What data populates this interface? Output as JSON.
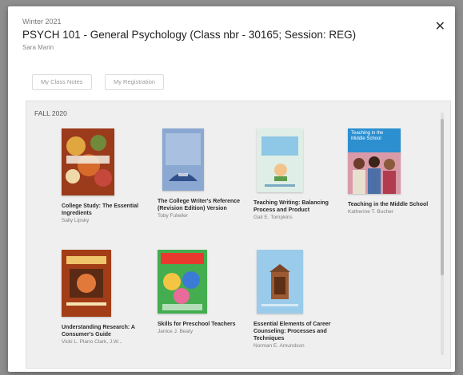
{
  "header": {
    "term": "Winter 2021",
    "title": "PSYCH 101 - General Psychology (Class nbr - 30165; Session: REG)",
    "subtitle": "Sara Marin"
  },
  "buttons": {
    "my_class_notes": "My Class Notes",
    "my_registration": "My Registration"
  },
  "panel": {
    "semester": "FALL 2020"
  },
  "books": [
    {
      "title": "College Study: The Essential Ingredients",
      "author": "Sally Lipsky"
    },
    {
      "title": "The College Writer's Reference (Revision Edition) Version",
      "author": "Toby Fulwiler"
    },
    {
      "title": "Teaching Writing: Balancing Process and Product",
      "author": "Gail E. Tompkins"
    },
    {
      "title": "Teaching in the Middle School",
      "author": "Katherine T. Bucher"
    },
    {
      "title": "Understanding Research: A Consumer's Guide",
      "author": "Vicki L. Plano Clark, J.W..."
    },
    {
      "title": "Skills for Preschool Teachers",
      "author": "Janice J. Beaty"
    },
    {
      "title": "Essential Elements of Career Counseling: Processes and Techniques",
      "author": "Norman E. Amundson"
    }
  ],
  "cover_text": {
    "book4": "Teaching in the Middle School"
  },
  "colors": {
    "overlay": "#8e8e8e",
    "panel_bg": "#efefef",
    "accent_blue": "#2b8fd0"
  },
  "icons": {
    "close": "close-icon"
  }
}
